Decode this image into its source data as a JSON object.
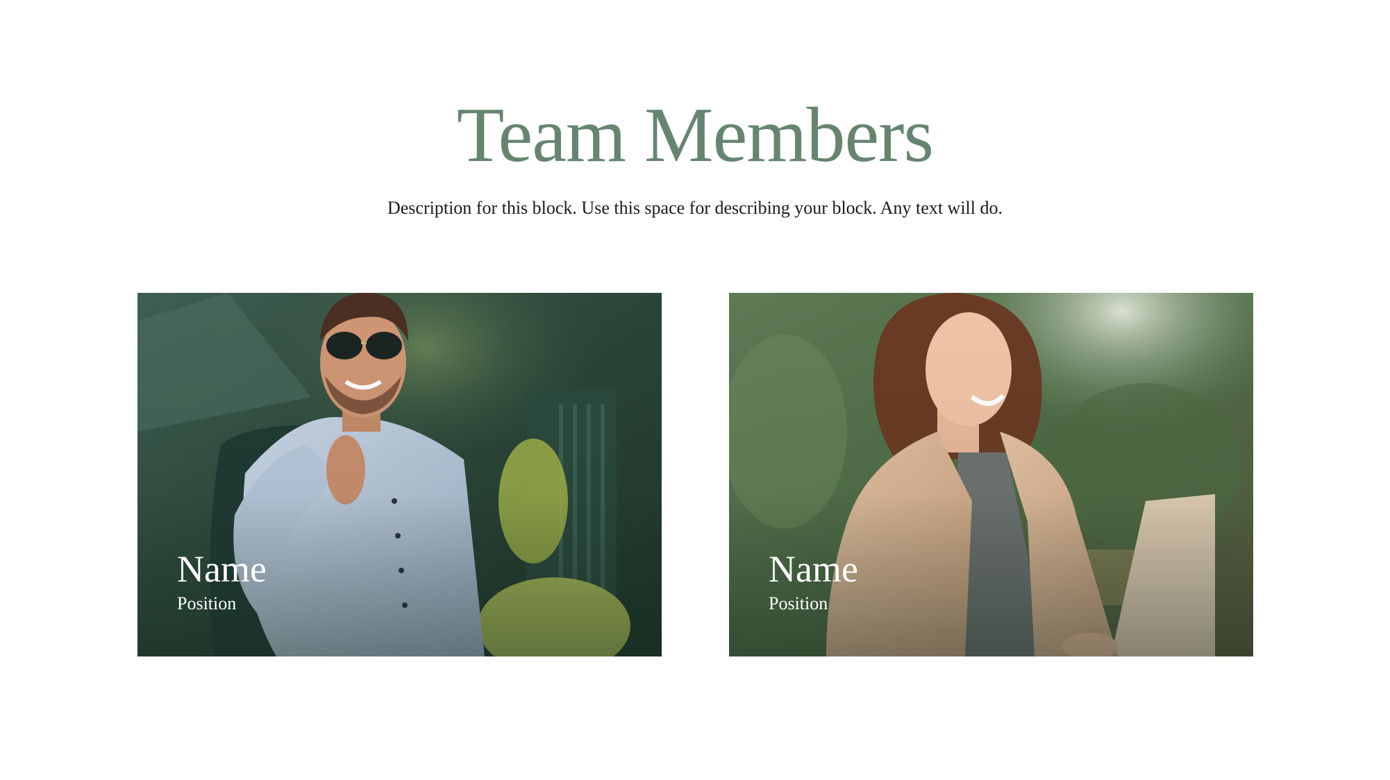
{
  "section": {
    "title": "Team Members",
    "description": "Description for this block. Use this space for describing your block. Any text will do."
  },
  "members": [
    {
      "name": "Name",
      "position": "Position",
      "photo": "man-in-blue-shirt-sunglasses-photo"
    },
    {
      "name": "Name",
      "position": "Position",
      "photo": "woman-in-beige-coat-laptop-photo"
    }
  ],
  "colors": {
    "title": "#668570",
    "text": "#1a1a1a",
    "card_text": "#ffffff"
  }
}
